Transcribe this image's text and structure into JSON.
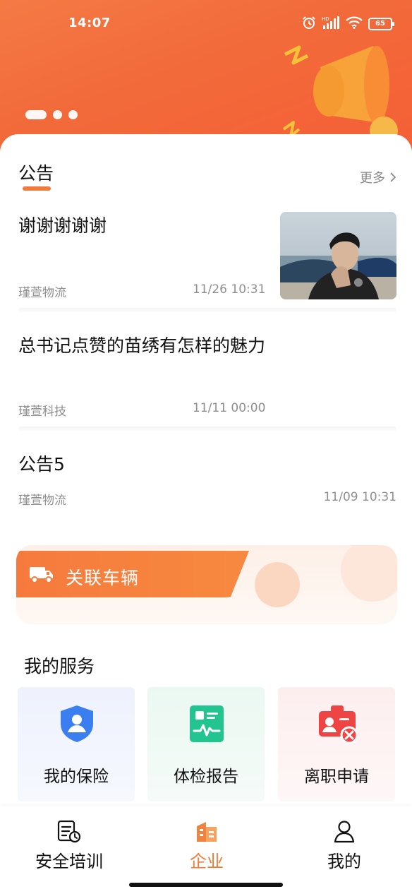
{
  "status_bar": {
    "time": "14:07",
    "battery": "65",
    "icons": [
      "alarm-icon",
      "hd-signal-icon",
      "wifi-icon",
      "battery-icon"
    ]
  },
  "banner": {
    "illustration": "megaphone-icon",
    "dots": 3,
    "active_dot": 0
  },
  "notice": {
    "title": "公告",
    "more_label": "更多",
    "items": [
      {
        "title": "谢谢谢谢谢",
        "source": "瑾萱物流",
        "date": "11/26 10:31",
        "has_thumbnail": true
      },
      {
        "title": "总书记点赞的苗绣有怎样的魅力",
        "source": "瑾萱科技",
        "date": "11/11 00:00",
        "has_thumbnail": false
      },
      {
        "title": "公告5",
        "source": "瑾萱物流",
        "date": "11/09 10:31",
        "has_thumbnail": false
      }
    ]
  },
  "vehicle": {
    "label": "关联车辆",
    "icon": "truck-icon"
  },
  "services": {
    "title": "我的服务",
    "items": [
      {
        "label": "我的保险",
        "icon": "insurance-shield-icon",
        "color": "#3b7ef0"
      },
      {
        "label": "体检报告",
        "icon": "health-report-icon",
        "color": "#22c48f"
      },
      {
        "label": "离职申请",
        "icon": "resignation-badge-icon",
        "color": "#ef4444"
      }
    ]
  },
  "bottom_nav": {
    "items": [
      {
        "label": "安全培训",
        "icon": "training-icon",
        "active": false
      },
      {
        "label": "企业",
        "icon": "company-building-icon",
        "active": true
      },
      {
        "label": "我的",
        "icon": "profile-icon",
        "active": false
      }
    ]
  },
  "colors": {
    "accent": "#f27a3b",
    "banner": "#f26a3a",
    "active_nav": "#f07a35"
  }
}
